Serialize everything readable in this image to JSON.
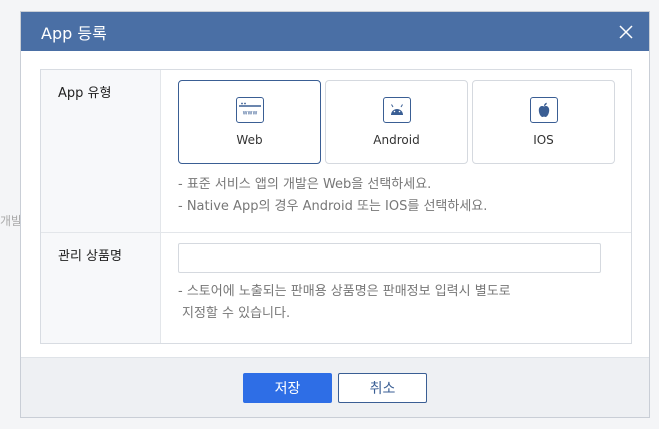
{
  "background": {
    "fragment_text": "개발자"
  },
  "dialog": {
    "title": "App 등록",
    "app_type": {
      "label": "App 유형",
      "options": [
        {
          "label": "Web",
          "icon": "browser-window-icon",
          "selected": true
        },
        {
          "label": "Android",
          "icon": "android-icon",
          "selected": false
        },
        {
          "label": "IOS",
          "icon": "apple-icon",
          "selected": false
        }
      ],
      "help": [
        "- 표준 서비스 앱의 개발은 Web을 선택하세요.",
        "- Native App의 경우 Android 또는 IOS를 선택하세요."
      ]
    },
    "product_name": {
      "label": "관리 상품명",
      "value": "",
      "placeholder": "",
      "help": [
        "- 스토어에 노출되는 판매용 상품명은 판매정보 입력시 별도로",
        "지정할 수 있습니다."
      ]
    },
    "buttons": {
      "save": "저장",
      "cancel": "취소"
    },
    "colors": {
      "header": "#4a6fa5",
      "primary": "#2e6ee6",
      "accent": "#3a5e94"
    }
  }
}
